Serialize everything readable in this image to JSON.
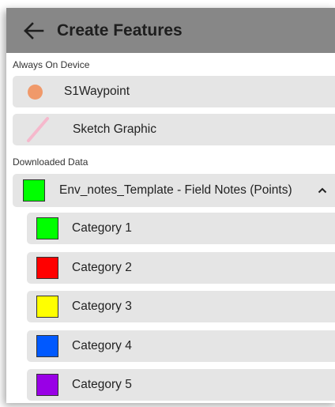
{
  "header": {
    "title": "Create Features"
  },
  "sections": {
    "always_on_device": "Always On Device",
    "downloaded_data": "Downloaded Data"
  },
  "device_items": [
    {
      "label": "S1Waypoint",
      "icon": "orange-circle-icon",
      "color": "#f0996a"
    },
    {
      "label": "Sketch Graphic",
      "icon": "sketch-line-icon",
      "color": "#f6b8cc"
    }
  ],
  "layer": {
    "label": "Env_notes_Template - Field Notes (Points)",
    "color": "#00ff00",
    "expanded": true
  },
  "categories": [
    {
      "label": "Category 1",
      "color": "#00ff00"
    },
    {
      "label": "Category 2",
      "color": "#ff0000"
    },
    {
      "label": "Category 3",
      "color": "#ffff00"
    },
    {
      "label": "Category 4",
      "color": "#0059ff"
    },
    {
      "label": "Category 5",
      "color": "#9900e6"
    }
  ]
}
